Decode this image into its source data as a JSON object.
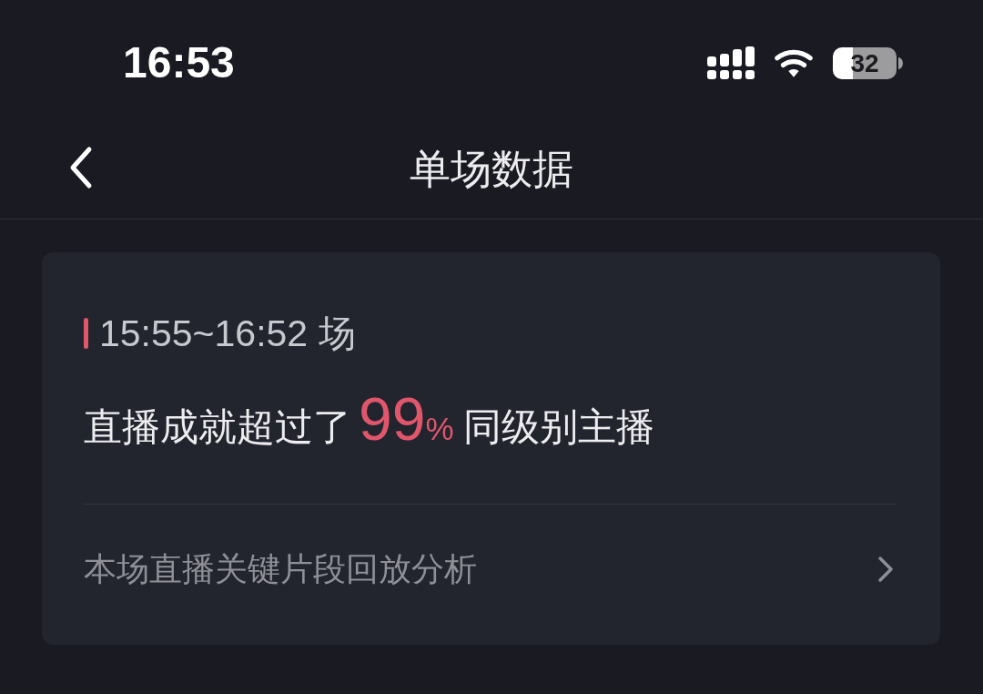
{
  "status_bar": {
    "time": "16:53",
    "battery": "32"
  },
  "nav": {
    "title": "单场数据"
  },
  "card": {
    "session": "15:55~16:52 场",
    "summary": {
      "before": "直播成就超过了",
      "value": "99",
      "unit": "%",
      "after": "同级别主播"
    },
    "link": "本场直播关键片段回放分析"
  }
}
